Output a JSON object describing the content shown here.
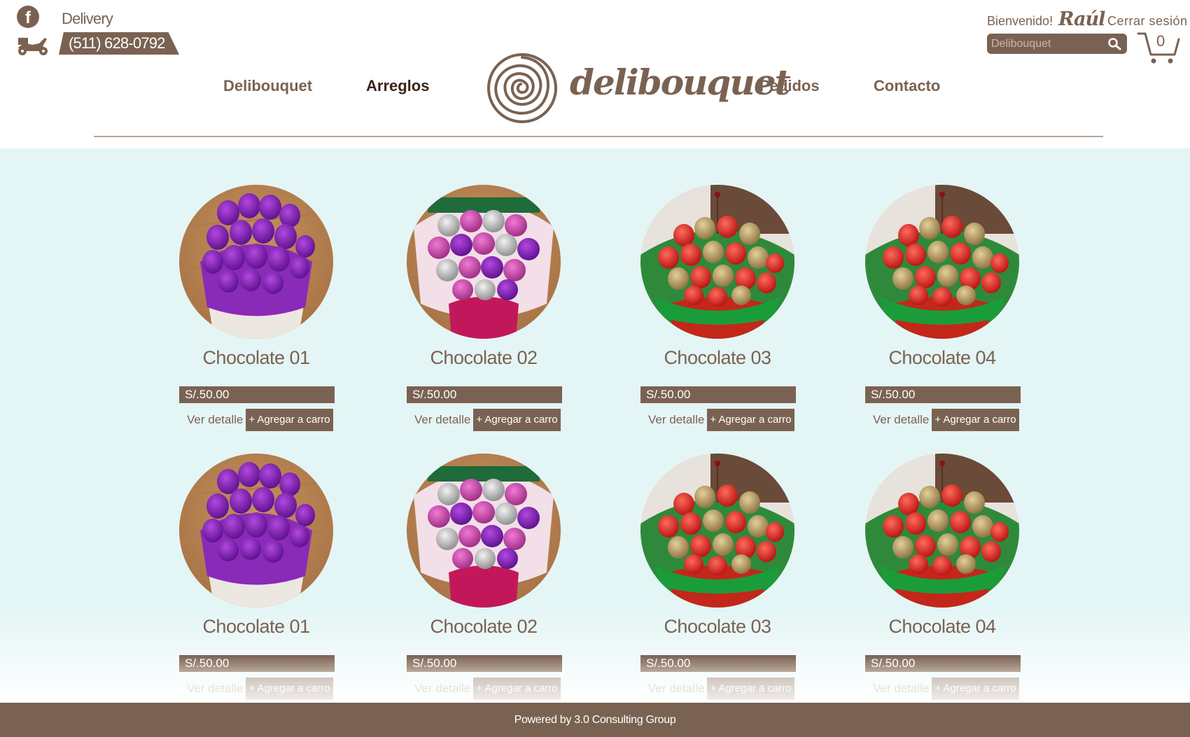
{
  "header": {
    "social_icon": "facebook-icon",
    "delivery_label": "Delivery",
    "delivery_icon": "scooter-icon",
    "phone": "(511) 628-0792",
    "nav": [
      {
        "label": "Delibouquet",
        "active": false
      },
      {
        "label": "Arreglos",
        "active": true
      },
      {
        "label": "Pedidos",
        "active": false
      },
      {
        "label": "Contacto",
        "active": false
      }
    ],
    "logo_text": "delibouquet",
    "welcome": "Bienvenido!",
    "user_name": "Raúl",
    "logout": "Cerrar sesión",
    "search_placeholder": "Delibouquet",
    "cart_count": "0"
  },
  "products": [
    {
      "name": "Chocolate 01",
      "price": "S/.50.00",
      "detail": "Ver detalle",
      "add": "+ Agregar a carro",
      "image": "purple-chocolate-bouquet"
    },
    {
      "name": "Chocolate 02",
      "price": "S/.50.00",
      "detail": "Ver detalle",
      "add": "+ Agregar a carro",
      "image": "pink-silver-chocolate-bouquet"
    },
    {
      "name": "Chocolate 03",
      "price": "S/.50.00",
      "detail": "Ver detalle",
      "add": "+ Agregar a carro",
      "image": "red-gold-chocolate-bouquet"
    },
    {
      "name": "Chocolate 04",
      "price": "S/.50.00",
      "detail": "Ver detalle",
      "add": "+ Agregar a carro",
      "image": "red-gold-chocolate-bouquet"
    },
    {
      "name": "Chocolate 01",
      "price": "S/.50.00",
      "detail": "Ver detalle",
      "add": "+ Agregar a carro",
      "image": "purple-chocolate-bouquet"
    },
    {
      "name": "Chocolate 02",
      "price": "S/.50.00",
      "detail": "Ver detalle",
      "add": "+ Agregar a carro",
      "image": "pink-silver-chocolate-bouquet"
    },
    {
      "name": "Chocolate 03",
      "price": "S/.50.00",
      "detail": "Ver detalle",
      "add": "+ Agregar a carro",
      "image": "red-gold-chocolate-bouquet"
    },
    {
      "name": "Chocolate 04",
      "price": "S/.50.00",
      "detail": "Ver detalle",
      "add": "+ Agregar a carro",
      "image": "red-gold-chocolate-bouquet"
    }
  ],
  "footer": {
    "text": "Powered by 3.0 Consulting Group"
  },
  "colors": {
    "brand": "#7a6252",
    "background": "#e4f5f5",
    "active_nav": "#3c2418"
  }
}
